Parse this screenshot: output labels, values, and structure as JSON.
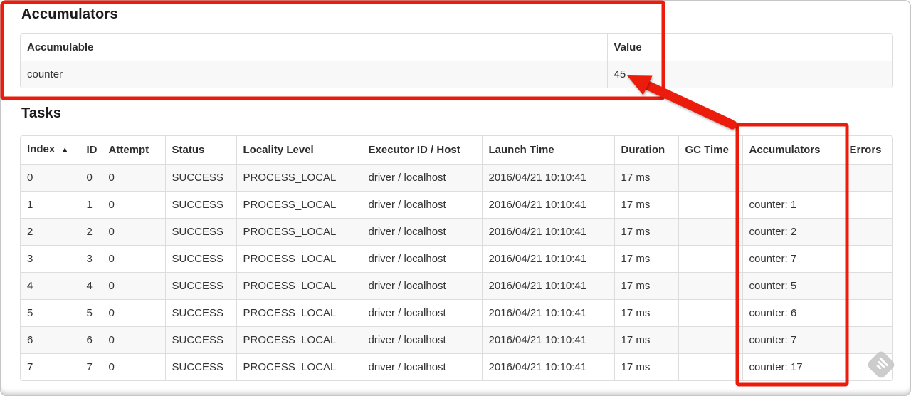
{
  "accumulators": {
    "title": "Accumulators",
    "headers": [
      "Accumulable",
      "Value"
    ],
    "rows": [
      [
        "counter",
        "45"
      ]
    ]
  },
  "tasks": {
    "title": "Tasks",
    "sort_icon": "▲",
    "headers": [
      "Index",
      "ID",
      "Attempt",
      "Status",
      "Locality Level",
      "Executor ID / Host",
      "Launch Time",
      "Duration",
      "GC Time",
      "Accumulators",
      "Errors"
    ],
    "rows": [
      [
        "0",
        "0",
        "0",
        "SUCCESS",
        "PROCESS_LOCAL",
        "driver / localhost",
        "2016/04/21 10:10:41",
        "17 ms",
        "",
        "",
        ""
      ],
      [
        "1",
        "1",
        "0",
        "SUCCESS",
        "PROCESS_LOCAL",
        "driver / localhost",
        "2016/04/21 10:10:41",
        "17 ms",
        "",
        "counter: 1",
        ""
      ],
      [
        "2",
        "2",
        "0",
        "SUCCESS",
        "PROCESS_LOCAL",
        "driver / localhost",
        "2016/04/21 10:10:41",
        "17 ms",
        "",
        "counter: 2",
        ""
      ],
      [
        "3",
        "3",
        "0",
        "SUCCESS",
        "PROCESS_LOCAL",
        "driver / localhost",
        "2016/04/21 10:10:41",
        "17 ms",
        "",
        "counter: 7",
        ""
      ],
      [
        "4",
        "4",
        "0",
        "SUCCESS",
        "PROCESS_LOCAL",
        "driver / localhost",
        "2016/04/21 10:10:41",
        "17 ms",
        "",
        "counter: 5",
        ""
      ],
      [
        "5",
        "5",
        "0",
        "SUCCESS",
        "PROCESS_LOCAL",
        "driver / localhost",
        "2016/04/21 10:10:41",
        "17 ms",
        "",
        "counter: 6",
        ""
      ],
      [
        "6",
        "6",
        "0",
        "SUCCESS",
        "PROCESS_LOCAL",
        "driver / localhost",
        "2016/04/21 10:10:41",
        "17 ms",
        "",
        "counter: 7",
        ""
      ],
      [
        "7",
        "7",
        "0",
        "SUCCESS",
        "PROCESS_LOCAL",
        "driver / localhost",
        "2016/04/21 10:10:41",
        "17 ms",
        "",
        "counter: 17",
        ""
      ]
    ]
  },
  "annotations": {
    "color": "#ec1c0c"
  }
}
